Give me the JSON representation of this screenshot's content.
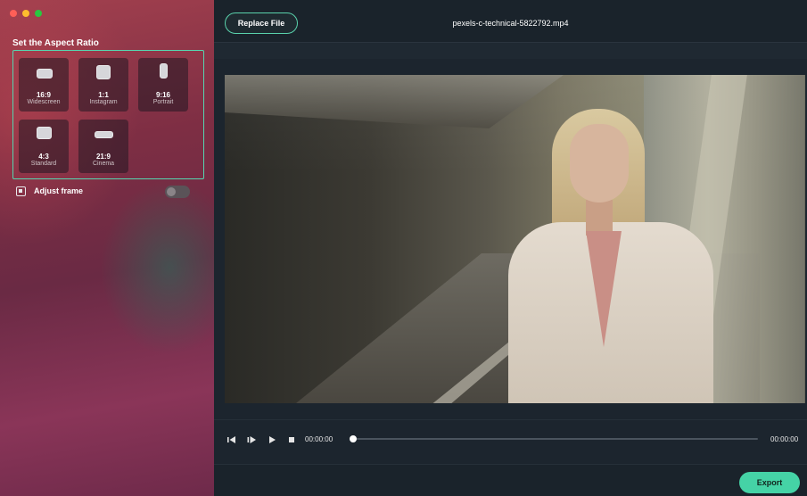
{
  "sidebar": {
    "section_title": "Set the Aspect Ratio",
    "ratios": [
      {
        "ratio": "16:9",
        "name": "Widescreen"
      },
      {
        "ratio": "1:1",
        "name": "Instagram"
      },
      {
        "ratio": "9:16",
        "name": "Portrait"
      },
      {
        "ratio": "4:3",
        "name": "Standard"
      },
      {
        "ratio": "21:9",
        "name": "Cinema"
      }
    ],
    "adjust_frame_label": "Adjust frame",
    "adjust_frame_enabled": false
  },
  "toolbar": {
    "replace_label": "Replace File",
    "file_name": "pexels-c-technical-5822792.mp4"
  },
  "player": {
    "current_time": "00:00:00",
    "total_time": "00:00:00",
    "progress": 0
  },
  "footer": {
    "export_label": "Export"
  },
  "colors": {
    "accent": "#45d3a6",
    "selection_border": "#56d6b0"
  },
  "icons": {
    "prev_frame": "step-back-icon",
    "next_frame": "step-forward-icon",
    "play": "play-icon",
    "stop": "stop-icon",
    "adjust": "crop-frame-icon"
  }
}
